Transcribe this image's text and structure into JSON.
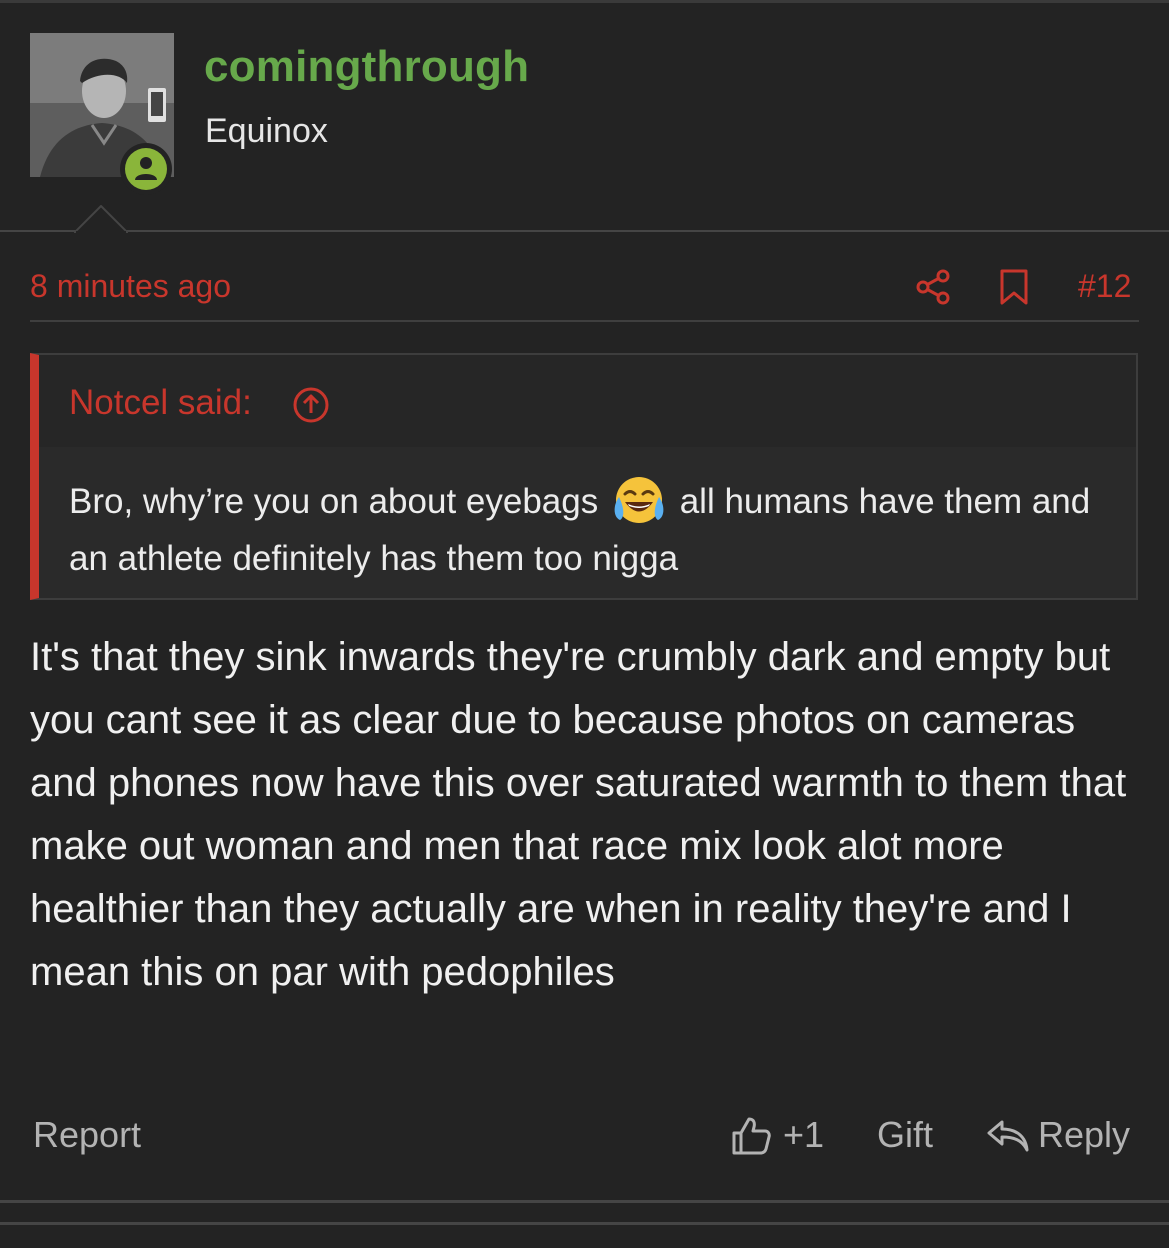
{
  "author": {
    "username": "comingthrough",
    "user_title": "Equinox",
    "avatar_icon": "user-avatar-photo",
    "status_icon": "online-person-icon"
  },
  "meta": {
    "timestamp": "8 minutes ago",
    "share_icon": "share-icon",
    "bookmark_icon": "bookmark-icon",
    "post_number": "#12"
  },
  "quote": {
    "author_label": "Notcel said:",
    "jump_icon": "arrow-up-circle-icon",
    "text_before_emoji": "Bro, why’re you on about eyebags",
    "emoji": "face-with-tears-of-joy",
    "text_after_emoji": "all humans have them and an athlete definitely has them too nigga"
  },
  "post": {
    "body": "It's that they sink inwards they're crumbly dark and empty but you cant see it as clear due to because photos on cameras and phones now have this over saturated warmth to them that make out woman and men that race mix look alot more healthier than they actually are when in reality they're and I mean this on par with pedophiles"
  },
  "actions": {
    "report_label": "Report",
    "like_icon": "thumbs-up-icon",
    "like_count": "+1",
    "gift_label": "Gift",
    "reply_icon": "reply-arrow-icon",
    "reply_label": "Reply"
  },
  "colors": {
    "background": "#232323",
    "username": "#67a94b",
    "accent_red": "#c8362c",
    "online_badge": "#8ab53a",
    "muted_text": "#b3b3b3"
  }
}
